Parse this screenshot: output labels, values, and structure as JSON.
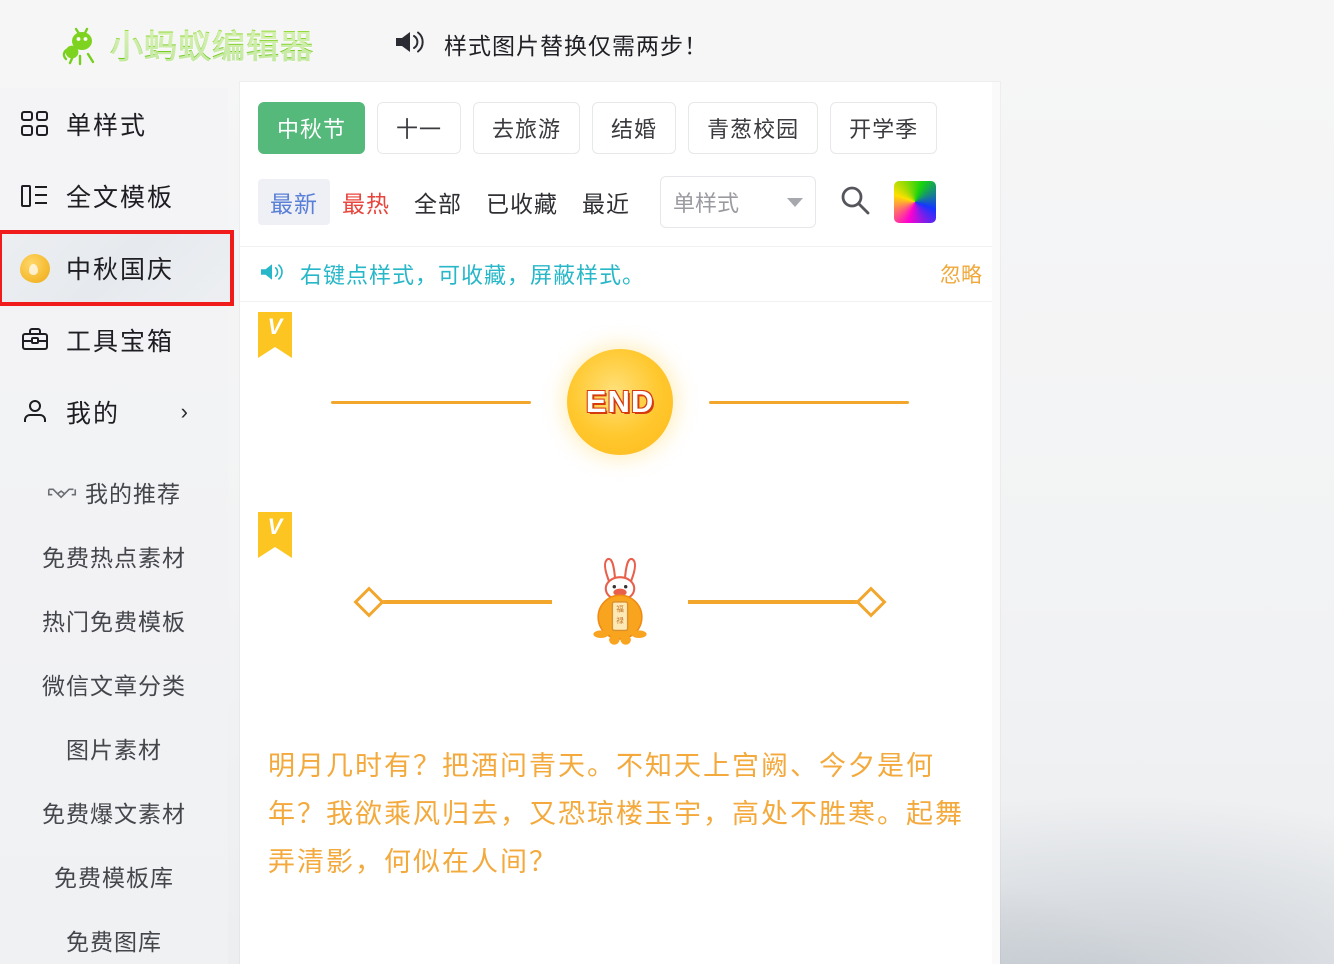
{
  "header": {
    "logo_text": "小蚂蚁编辑器",
    "logo_icon": "ant-icon",
    "announcement_icon": "speaker-icon",
    "announcement": "样式图片替换仅需两步！",
    "brand_color": "#7ed321"
  },
  "sidebar": {
    "items": [
      {
        "label": "单样式",
        "icon": "grid-icon",
        "highlighted": false
      },
      {
        "label": "全文模板",
        "icon": "template-icon",
        "highlighted": false
      },
      {
        "label": "中秋国庆",
        "icon": "moon-icon",
        "highlighted": true
      },
      {
        "label": "工具宝箱",
        "icon": "toolbox-icon",
        "highlighted": false
      },
      {
        "label": "我的",
        "icon": "user-icon",
        "highlighted": false,
        "chevron": "›"
      }
    ],
    "sub_items": [
      {
        "label": "我的推荐",
        "icon": "handshake-icon"
      },
      {
        "label": "免费热点素材",
        "icon": ""
      },
      {
        "label": "热门免费模板",
        "icon": ""
      },
      {
        "label": "微信文章分类",
        "icon": ""
      },
      {
        "label": "图片素材",
        "icon": ""
      },
      {
        "label": "免费爆文素材",
        "icon": ""
      },
      {
        "label": "免费模板库",
        "icon": ""
      },
      {
        "label": "免费图库",
        "icon": ""
      }
    ],
    "highlight_color": "#f01b1b"
  },
  "panel": {
    "categories": [
      {
        "label": "中秋节",
        "active": true
      },
      {
        "label": "十一",
        "active": false
      },
      {
        "label": "去旅游",
        "active": false
      },
      {
        "label": "结婚",
        "active": false
      },
      {
        "label": "青葱校园",
        "active": false
      },
      {
        "label": "开学季",
        "active": false
      }
    ],
    "active_category_color": "#54b97a",
    "filters": [
      {
        "label": "最新",
        "state": "selected"
      },
      {
        "label": "最热",
        "state": "hot"
      },
      {
        "label": "全部",
        "state": "normal"
      },
      {
        "label": "已收藏",
        "state": "normal"
      },
      {
        "label": "最近",
        "state": "normal"
      }
    ],
    "select": {
      "value": "单样式",
      "caret": "▾"
    },
    "search_icon": "search-icon",
    "palette_icon": "color-palette-icon",
    "tip": {
      "icon": "speaker-icon",
      "text": "右键点样式，可收藏，屏蔽样式。",
      "ignore_label": "忽略",
      "text_color": "#27b7c8",
      "ignore_color": "#f0a83a"
    },
    "styles": [
      {
        "vip_badge": "V",
        "kind": "end-circle-divider",
        "center_text": "END"
      },
      {
        "vip_badge": "V",
        "kind": "rabbit-diamond-divider",
        "center_text": ""
      }
    ],
    "poem": "明月几时有？把酒问青天。不知天上宫阙、今夕是何年？我欲乘风归去，又恐琼楼玉宇，高处不胜寒。起舞弄清影，何似在人间？",
    "poem_color": "#f3a93c"
  }
}
